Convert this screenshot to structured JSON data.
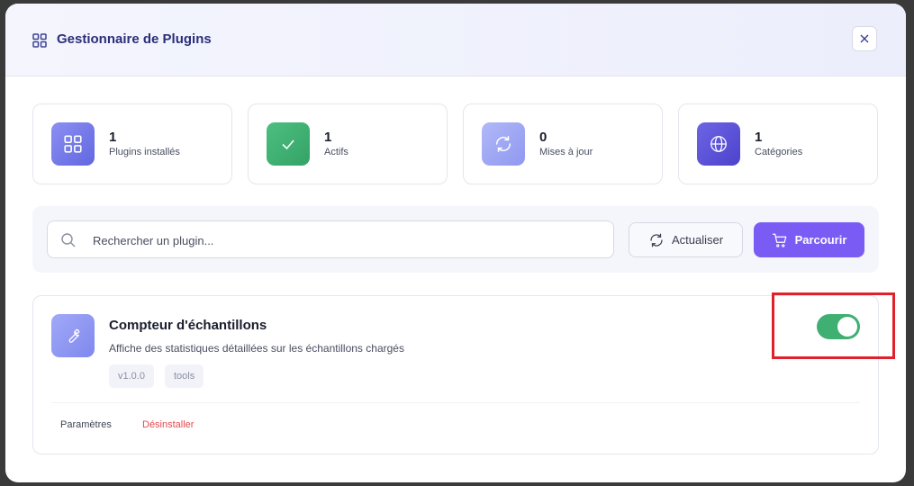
{
  "header": {
    "title": "Gestionnaire de Plugins",
    "title_icon": "grid-icon",
    "close_icon": "close-icon"
  },
  "stats": [
    {
      "value": "1",
      "label": "Plugins installés",
      "icon": "grid-icon",
      "color": "#6f74e8"
    },
    {
      "value": "1",
      "label": "Actifs",
      "icon": "check-icon",
      "color": "#3faf72"
    },
    {
      "value": "0",
      "label": "Mises à jour",
      "icon": "refresh-icon",
      "color": "#9ea6f5"
    },
    {
      "value": "1",
      "label": "Catégories",
      "icon": "globe-icon",
      "color": "#5b52d8"
    }
  ],
  "toolbar": {
    "search_placeholder": "Rechercher un plugin...",
    "refresh_label": "Actualiser",
    "browse_label": "Parcourir",
    "browse_color": "#7a5cf4"
  },
  "plugin": {
    "name": "Compteur d'échantillons",
    "description": "Affiche des statistiques détaillées sur les échantillons chargés",
    "version": "v1.0.0",
    "tag": "tools",
    "settings_label": "Paramètres",
    "uninstall_label": "Désinstaller",
    "enabled": true,
    "icon": "wrench-icon"
  },
  "colors": {
    "accent": "#7a5cf4",
    "toggle_on": "#3faf72",
    "danger": "#e5484d",
    "highlight": "#e0202a"
  }
}
